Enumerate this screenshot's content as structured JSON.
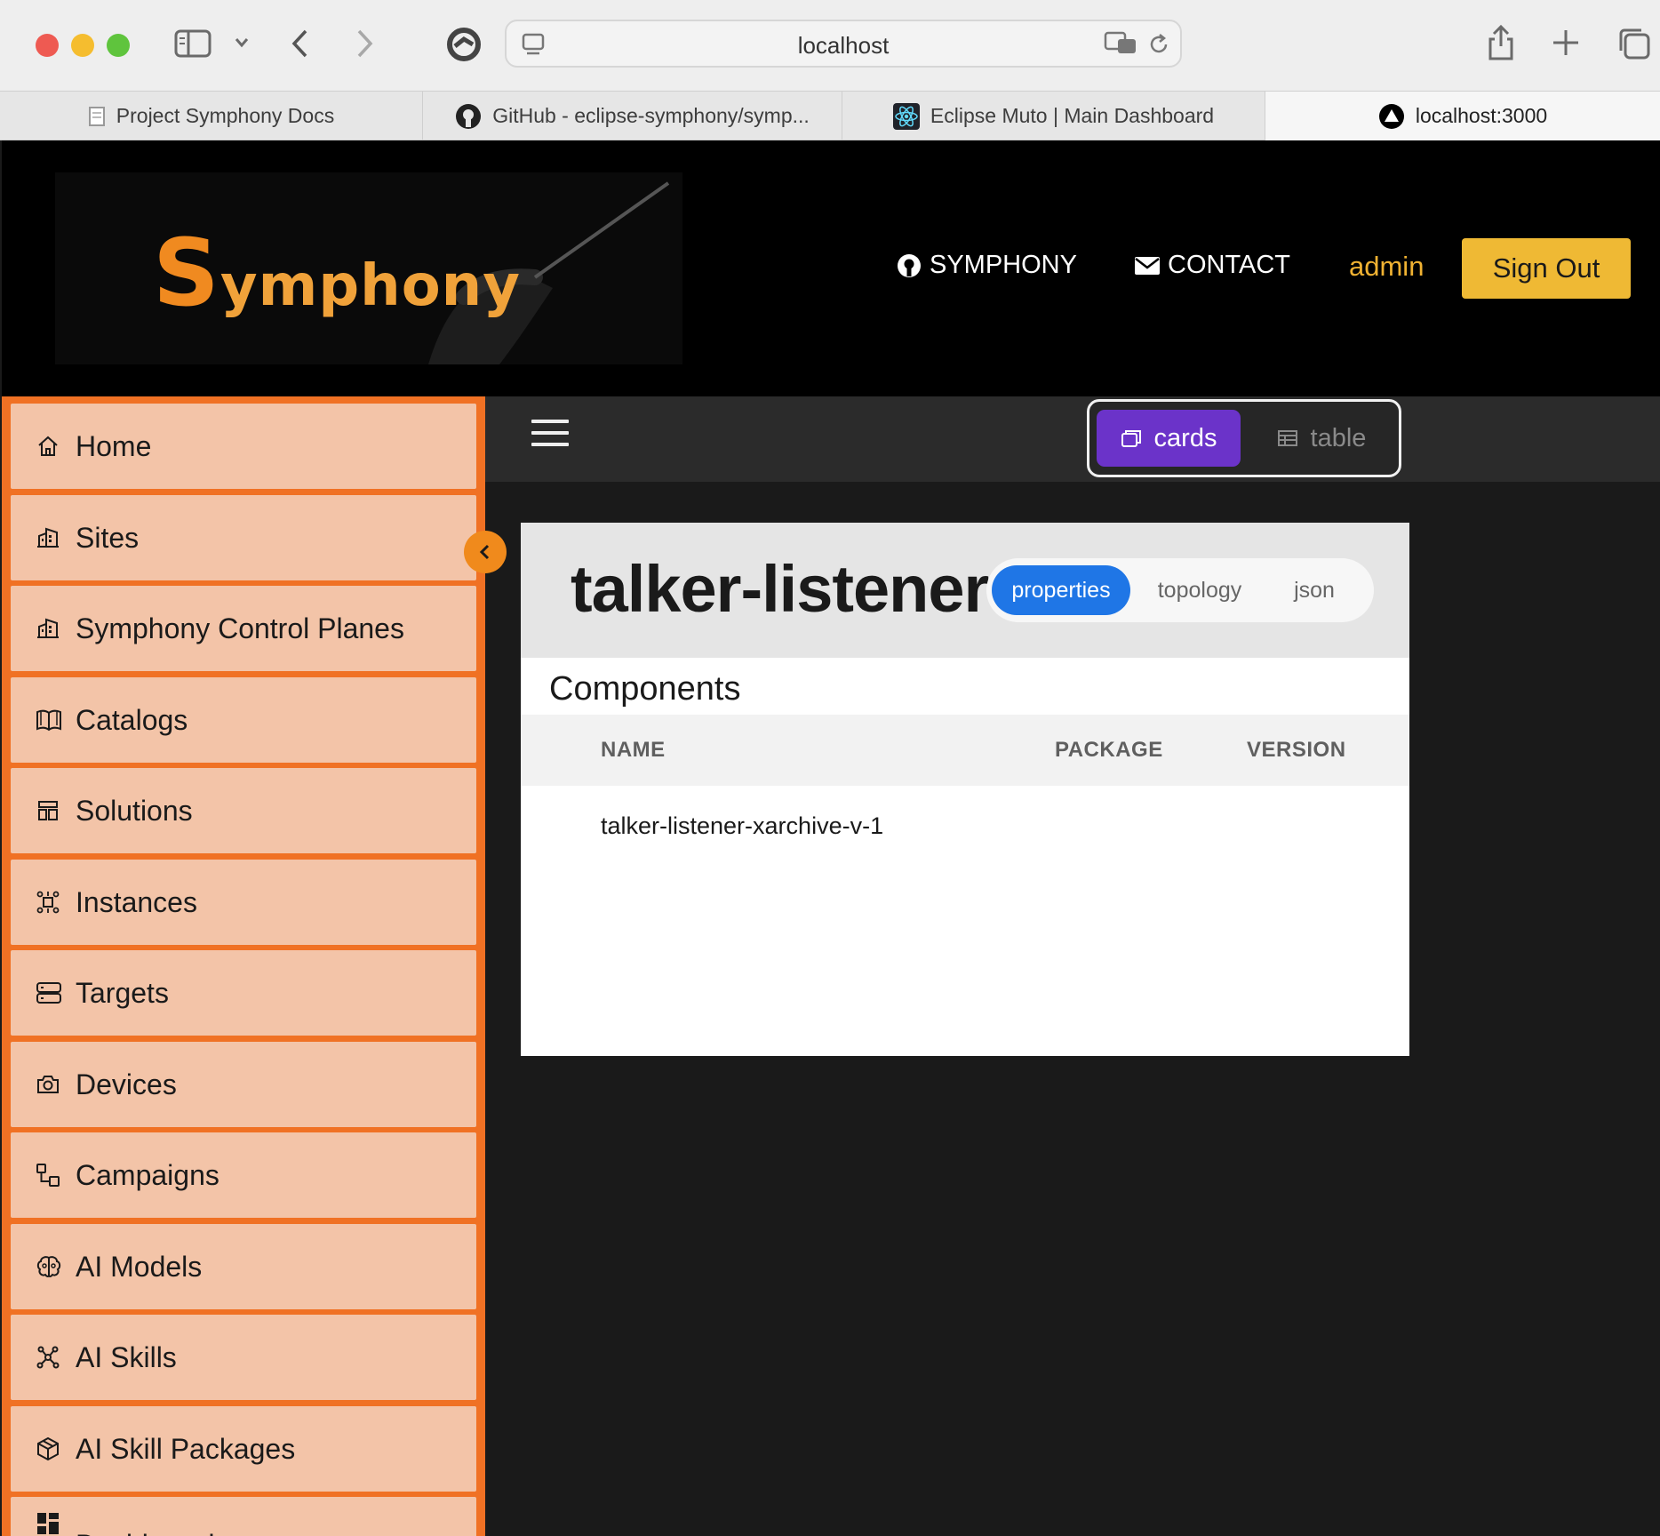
{
  "browser": {
    "url": "localhost",
    "tabs": [
      {
        "label": "Project Symphony Docs"
      },
      {
        "label": "GitHub - eclipse-symphony/symp..."
      },
      {
        "label": "Eclipse Muto | Main Dashboard"
      },
      {
        "label": "localhost:3000"
      }
    ]
  },
  "header": {
    "logo_text": "ymphony",
    "logo_initial": "S",
    "symphony_link": "SYMPHONY",
    "contact_link": "CONTACT",
    "user": "admin",
    "sign_out": "Sign Out"
  },
  "sidebar": {
    "items": [
      {
        "label": "Home",
        "icon": "home-icon"
      },
      {
        "label": "Sites",
        "icon": "building-icon"
      },
      {
        "label": "Symphony Control Planes",
        "icon": "building-icon"
      },
      {
        "label": "Catalogs",
        "icon": "book-icon"
      },
      {
        "label": "Solutions",
        "icon": "layout-icon"
      },
      {
        "label": "Instances",
        "icon": "cluster-icon"
      },
      {
        "label": "Targets",
        "icon": "server-icon"
      },
      {
        "label": "Devices",
        "icon": "camera-icon"
      },
      {
        "label": "Campaigns",
        "icon": "workflow-icon"
      },
      {
        "label": "AI Models",
        "icon": "brain-icon"
      },
      {
        "label": "AI Skills",
        "icon": "nodes-icon"
      },
      {
        "label": "AI Skill Packages",
        "icon": "package-icon"
      },
      {
        "label": "Dashboard",
        "icon": "dashboard-icon"
      }
    ]
  },
  "view_toggle": {
    "cards": "cards",
    "table": "table",
    "selected": "cards"
  },
  "card": {
    "title": "talker-listener-",
    "tabs": [
      "properties",
      "topology",
      "json"
    ],
    "active_tab": "properties",
    "section_title": "Components",
    "columns": [
      "NAME",
      "PACKAGE",
      "VERSION"
    ],
    "rows": [
      {
        "name": "talker-listener-xarchive-v-1",
        "package": "",
        "version": ""
      }
    ]
  },
  "colors": {
    "sidebar_bg": "#f07124",
    "nav_item_bg": "#f3c4a8",
    "sign_out_bg": "#efb934",
    "admin_text": "#f0b232",
    "cards_toggle": "#6b33c9",
    "active_tab": "#1f76e6"
  }
}
